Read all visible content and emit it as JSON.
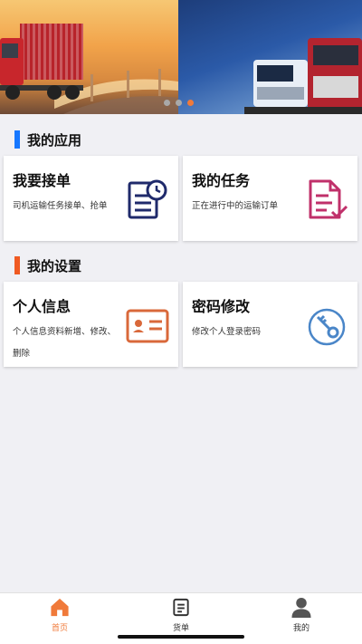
{
  "colors": {
    "accent": "#f07a3a",
    "blue_bar": "#1677ff",
    "orange_bar": "#f05a22",
    "navy_icon": "#1f2a6b",
    "magenta_icon": "#c0306a",
    "orange_icon": "#d9683a",
    "blue_icon": "#4a86c8"
  },
  "banner": {
    "slide_count": 3,
    "active_slide": 2
  },
  "sections": {
    "apps": {
      "title": "我的应用"
    },
    "settings": {
      "title": "我的设置"
    }
  },
  "cards": {
    "take_order": {
      "title": "我要接单",
      "desc": "司机运输任务接单、抢单",
      "icon": "calendar-doc-icon"
    },
    "my_tasks": {
      "title": "我的任务",
      "desc": "正在进行中的运输订单",
      "icon": "doc-check-icon"
    },
    "profile": {
      "title": "个人信息",
      "desc": "个人信息资料新增、修改、删除",
      "icon": "id-card-icon"
    },
    "password": {
      "title": "密码修改",
      "desc": "修改个人登录密码",
      "icon": "key-icon"
    }
  },
  "tabbar": {
    "home": {
      "label": "首页",
      "icon": "home-icon"
    },
    "orders": {
      "label": "货单",
      "icon": "list-doc-icon"
    },
    "mine": {
      "label": "我的",
      "icon": "user-icon"
    }
  }
}
